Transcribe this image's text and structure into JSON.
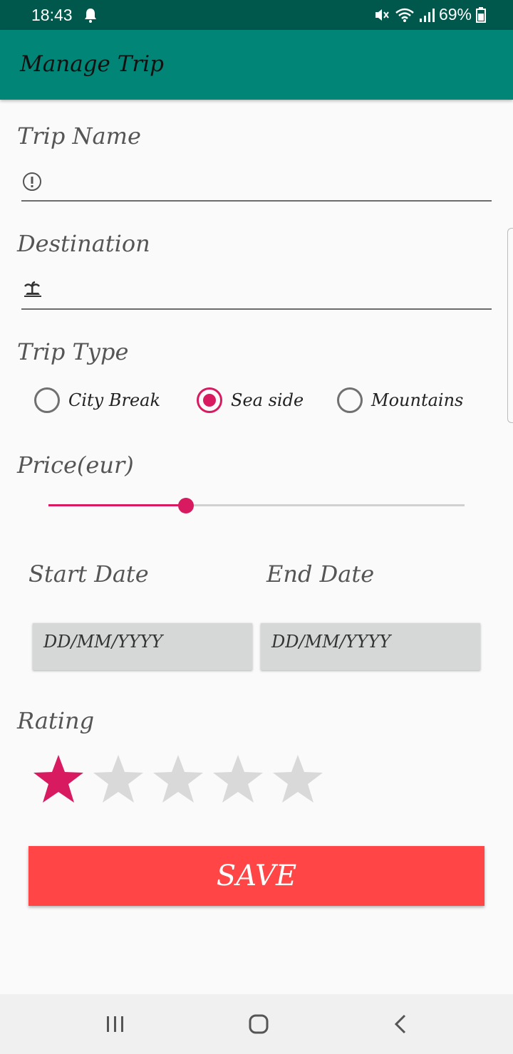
{
  "status_bar": {
    "time": "18:43",
    "battery": "69%",
    "icons": [
      "notification-icon",
      "mute-icon",
      "wifi-icon",
      "signal-icon",
      "battery-icon"
    ]
  },
  "app_bar": {
    "title": "Manage Trip",
    "color": "#008577"
  },
  "form": {
    "trip_name": {
      "label": "Trip Name",
      "value": "",
      "icon": "info-icon"
    },
    "destination": {
      "label": "Destination",
      "value": "",
      "icon": "island-icon"
    },
    "trip_type": {
      "label": "Trip Type",
      "options": [
        "City Break",
        "Sea side",
        "Mountains"
      ],
      "selected": "Sea side"
    },
    "price": {
      "label": "Price(eur)",
      "fraction": 0.33
    },
    "start_date": {
      "label": "Start Date",
      "placeholder": "DD/MM/YYYY"
    },
    "end_date": {
      "label": "End Date",
      "placeholder": "DD/MM/YYYY"
    },
    "rating": {
      "label": "Rating",
      "value": 1,
      "max": 5
    },
    "save_label": "SAVE"
  },
  "colors": {
    "accent": "#d81b60",
    "save": "#ff4545",
    "status_bar": "#00574b"
  },
  "nav_bar": {
    "icons": [
      "recent-apps-icon",
      "home-icon",
      "back-icon"
    ]
  }
}
